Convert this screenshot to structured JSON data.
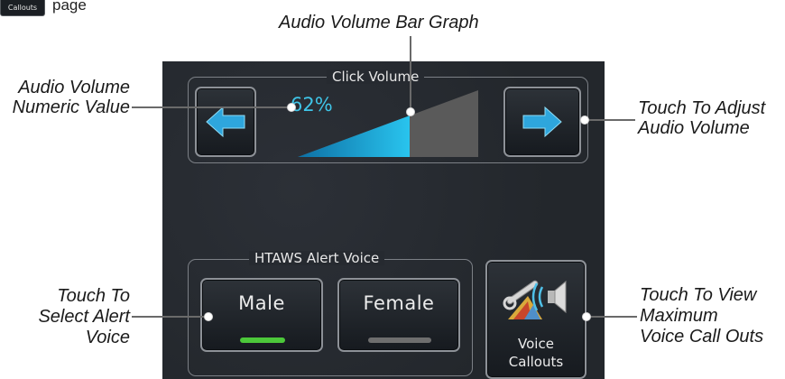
{
  "corner": {
    "chip_label": "Callouts",
    "fragment_text": "page"
  },
  "click_volume": {
    "title": "Click Volume",
    "value_text": "62%",
    "level_fraction": 0.62,
    "decrease_icon": "left-arrow-icon",
    "increase_icon": "right-arrow-icon"
  },
  "alert_voice": {
    "title": "HTAWS Alert Voice",
    "male_label": "Male",
    "female_label": "Female",
    "selected": "Male"
  },
  "voice_callouts": {
    "line1": "Voice",
    "line2": "Callouts",
    "icon": "wrench-speaker-icon"
  },
  "callouts": {
    "bar_graph": "Audio Volume Bar Graph",
    "numeric_line1": "Audio Volume",
    "numeric_line2": "Numeric Value",
    "adjust_line1": "Touch To Adjust",
    "adjust_line2": "Audio Volume",
    "select_line1": "Touch To",
    "select_line2": "Select Alert",
    "select_line3": "Voice",
    "view_line1": "Touch To View",
    "view_line2": "Maximum",
    "view_line3": "Voice Call Outs"
  },
  "colors": {
    "accent_cyan": "#3fc5e8",
    "selected_indicator": "#4cc83a",
    "unselected_indicator": "#6e6e6e",
    "screen_bg": "#262a30"
  }
}
